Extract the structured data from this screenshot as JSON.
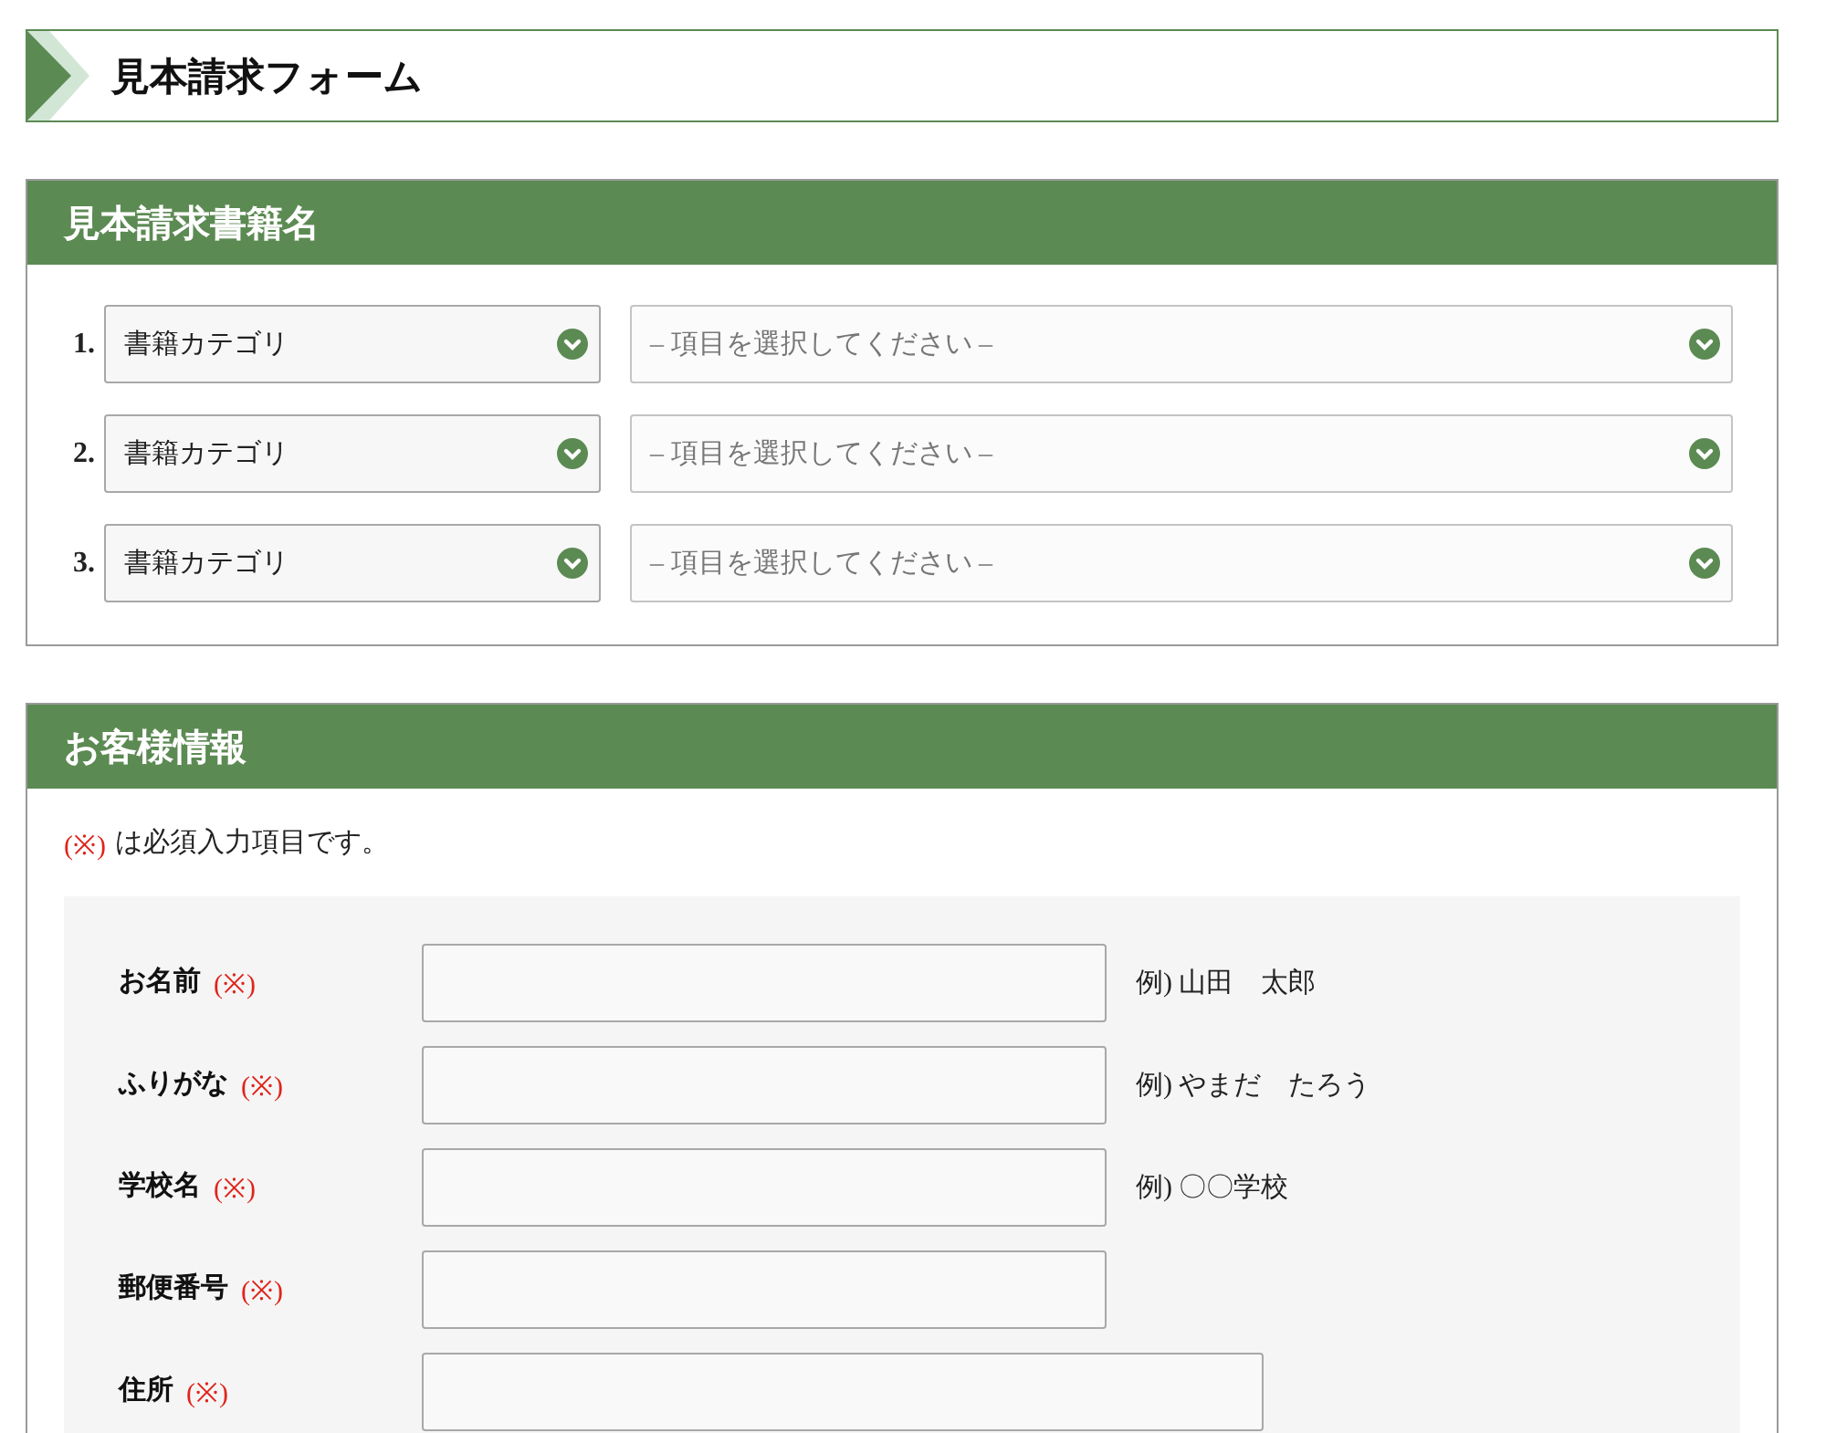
{
  "page_title": "見本請求フォーム",
  "books_section": {
    "title": "見本請求書籍名",
    "rows": [
      {
        "number": "1.",
        "category": "書籍カテゴリ",
        "item_placeholder": "– 項目を選択してください –"
      },
      {
        "number": "2.",
        "category": "書籍カテゴリ",
        "item_placeholder": "– 項目を選択してください –"
      },
      {
        "number": "3.",
        "category": "書籍カテゴリ",
        "item_placeholder": "– 項目を選択してください –"
      }
    ]
  },
  "customer_section": {
    "title": "お客様情報",
    "note": {
      "mark": "(※)",
      "text": "は必須入力項目です。"
    },
    "fields": [
      {
        "label": "お名前",
        "required_mark": "(※)",
        "kind": "short",
        "example": "例) 山田　太郎"
      },
      {
        "label": "ふりがな",
        "required_mark": "(※)",
        "kind": "short",
        "example": "例) やまだ　たろう"
      },
      {
        "label": "学校名",
        "required_mark": "(※)",
        "kind": "short",
        "example": "例) 〇〇学校"
      },
      {
        "label": "郵便番号",
        "required_mark": "(※)",
        "kind": "short"
      },
      {
        "label": "住所",
        "required_mark": "(※)",
        "kind": "long"
      }
    ]
  }
}
